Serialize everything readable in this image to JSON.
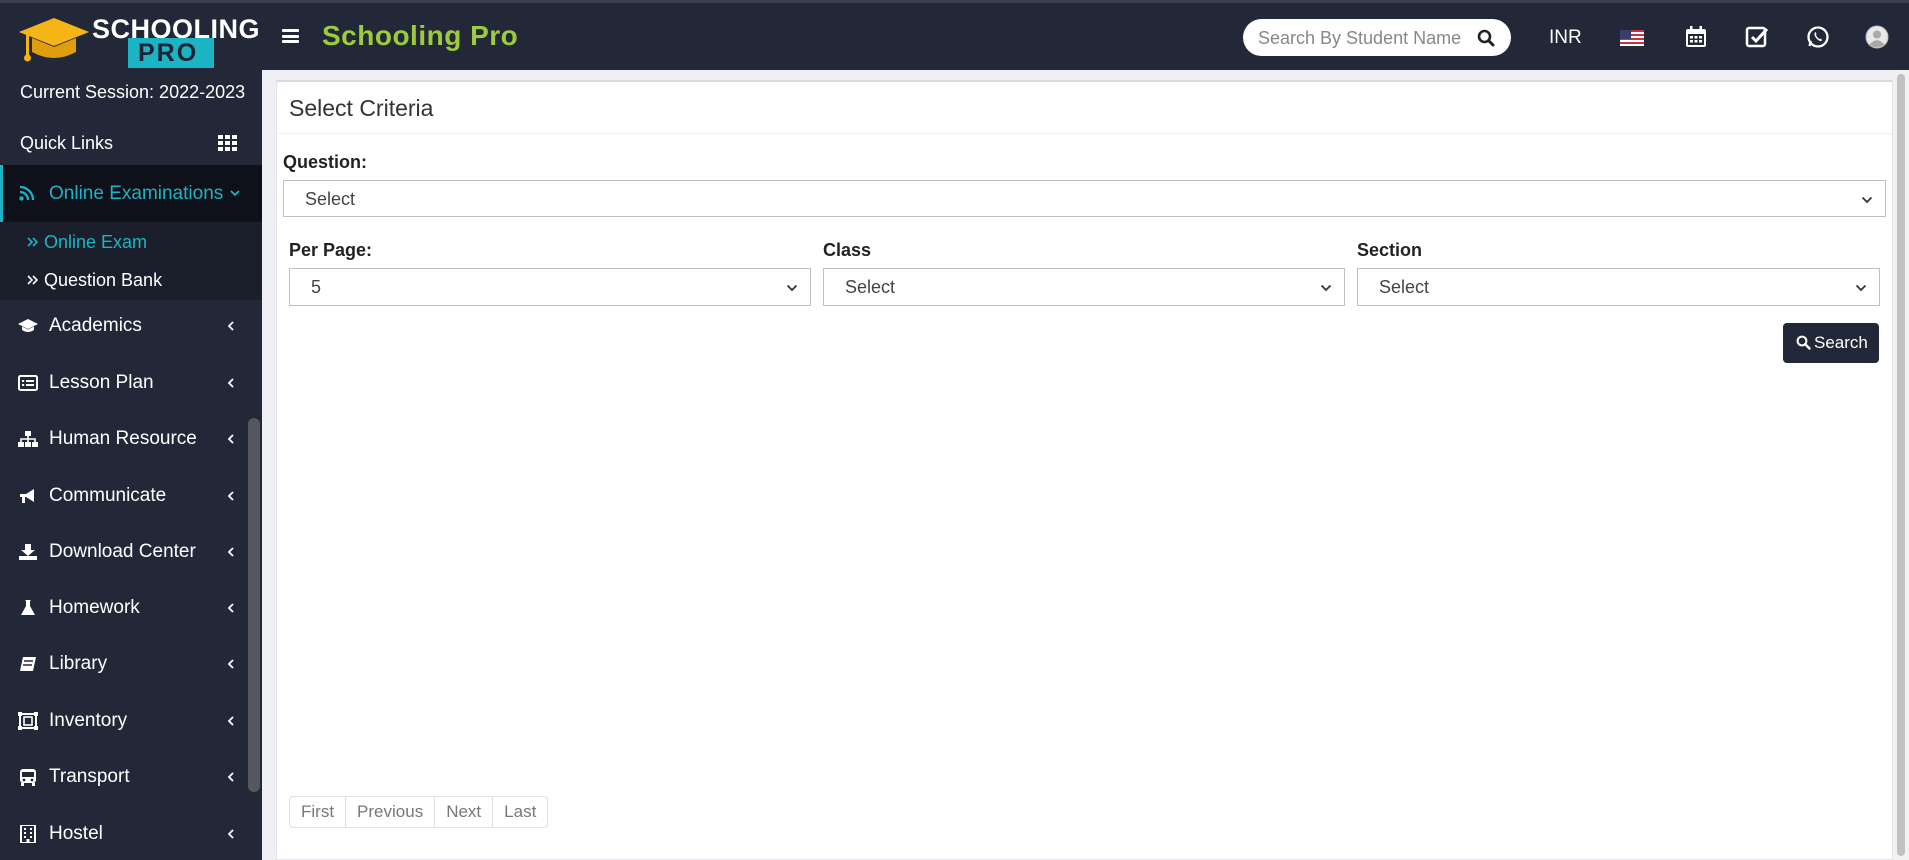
{
  "header": {
    "logo_line1": "SCHOOLING",
    "logo_line2": "PRO",
    "app_title": "Schooling Pro",
    "search_placeholder": "Search By Student Name",
    "currency": "INR",
    "icons": [
      "calendar-icon",
      "check-square-icon",
      "whatsapp-icon",
      "user-avatar-icon"
    ]
  },
  "sidebar": {
    "session": "Current Session: 2022-2023",
    "quick_links": "Quick Links",
    "active_section": "Online Examinations",
    "sub_items": [
      {
        "label": "Online Exam",
        "active": true
      },
      {
        "label": "Question Bank",
        "active": false
      }
    ],
    "items": [
      {
        "label": "Academics",
        "icon": "graduation-cap-icon"
      },
      {
        "label": "Lesson Plan",
        "icon": "list-alt-icon"
      },
      {
        "label": "Human Resource",
        "icon": "sitemap-icon"
      },
      {
        "label": "Communicate",
        "icon": "bullhorn-icon"
      },
      {
        "label": "Download Center",
        "icon": "download-icon"
      },
      {
        "label": "Homework",
        "icon": "flask-icon"
      },
      {
        "label": "Library",
        "icon": "book-icon"
      },
      {
        "label": "Inventory",
        "icon": "inventory-icon"
      },
      {
        "label": "Transport",
        "icon": "bus-icon"
      },
      {
        "label": "Hostel",
        "icon": "building-icon"
      }
    ]
  },
  "panel": {
    "title": "Select Criteria",
    "question_label": "Question:",
    "question_value": "Select",
    "per_page_label": "Per Page:",
    "per_page_value": "5",
    "class_label": "Class",
    "class_value": "Select",
    "section_label": "Section",
    "section_value": "Select",
    "search_button": "Search",
    "pager": {
      "first": "First",
      "previous": "Previous",
      "next": "Next",
      "last": "Last"
    }
  },
  "colors": {
    "sidebar_bg": "#232838",
    "accent": "#1ab4c4",
    "title_green": "#9ccc3c"
  }
}
